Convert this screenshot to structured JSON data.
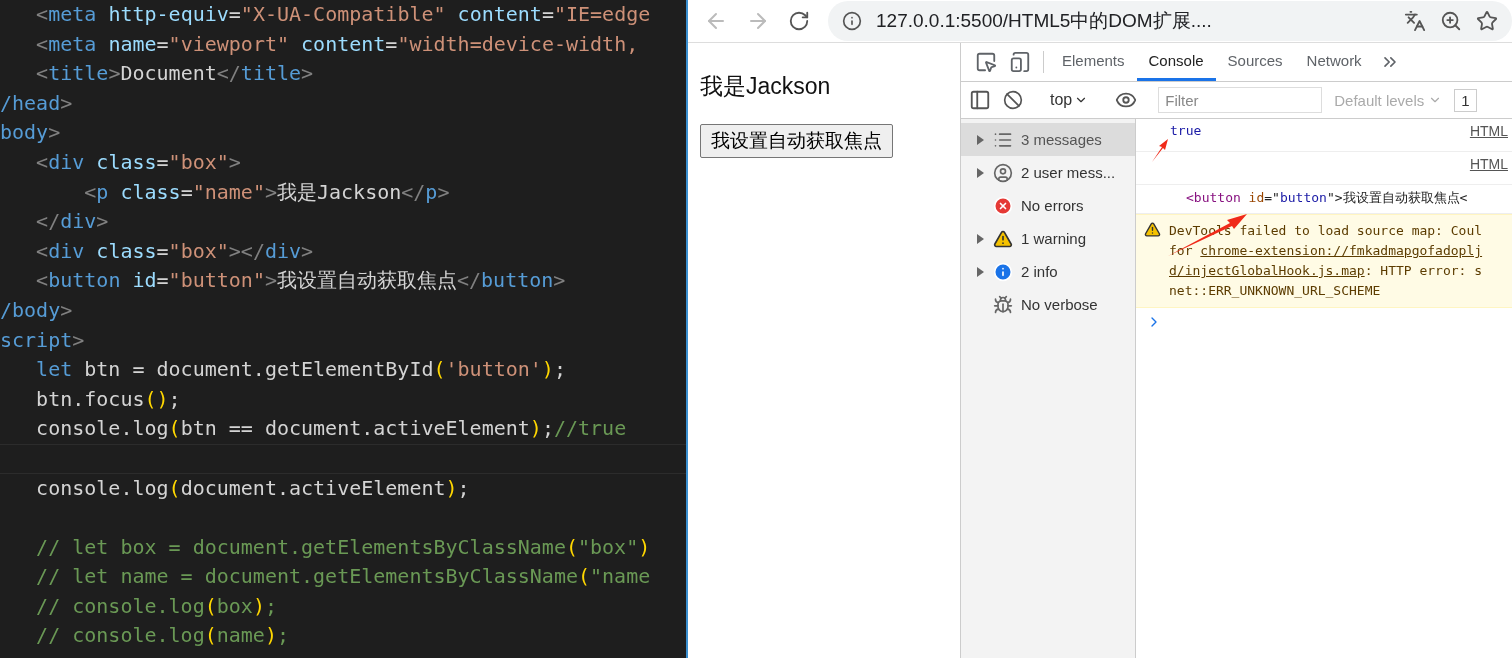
{
  "editor": {
    "lines": [
      {
        "tokens": [
          {
            "kind": "punct",
            "text": "   <"
          },
          {
            "kind": "tag",
            "text": "meta"
          },
          {
            "kind": "attr",
            "text": " http-equiv"
          },
          {
            "kind": "text",
            "text": "="
          },
          {
            "kind": "string",
            "text": "\"X-UA-Compatible\""
          },
          {
            "kind": "attr",
            "text": " content"
          },
          {
            "kind": "text",
            "text": "="
          },
          {
            "kind": "string",
            "text": "\"IE=edge"
          }
        ]
      },
      {
        "tokens": [
          {
            "kind": "punct",
            "text": "   <"
          },
          {
            "kind": "tag",
            "text": "meta"
          },
          {
            "kind": "attr",
            "text": " name"
          },
          {
            "kind": "text",
            "text": "="
          },
          {
            "kind": "string",
            "text": "\"viewport\""
          },
          {
            "kind": "attr",
            "text": " content"
          },
          {
            "kind": "text",
            "text": "="
          },
          {
            "kind": "string",
            "text": "\"width=device-width,"
          }
        ]
      },
      {
        "tokens": [
          {
            "kind": "punct",
            "text": "   <"
          },
          {
            "kind": "tag",
            "text": "title"
          },
          {
            "kind": "punct",
            "text": ">"
          },
          {
            "kind": "text",
            "text": "Document"
          },
          {
            "kind": "punct",
            "text": "</"
          },
          {
            "kind": "tag",
            "text": "title"
          },
          {
            "kind": "punct",
            "text": ">"
          }
        ]
      },
      {
        "tokens": [
          {
            "kind": "tag",
            "text": "/head"
          },
          {
            "kind": "punct",
            "text": ">"
          }
        ]
      },
      {
        "tokens": [
          {
            "kind": "tag",
            "text": "body"
          },
          {
            "kind": "punct",
            "text": ">"
          }
        ]
      },
      {
        "tokens": [
          {
            "kind": "punct",
            "text": "   <"
          },
          {
            "kind": "tag",
            "text": "div"
          },
          {
            "kind": "attr",
            "text": " class"
          },
          {
            "kind": "text",
            "text": "="
          },
          {
            "kind": "string",
            "text": "\"box\""
          },
          {
            "kind": "punct",
            "text": ">"
          }
        ]
      },
      {
        "tokens": [
          {
            "kind": "punct",
            "text": "       <"
          },
          {
            "kind": "tag",
            "text": "p"
          },
          {
            "kind": "attr",
            "text": " class"
          },
          {
            "kind": "text",
            "text": "="
          },
          {
            "kind": "string",
            "text": "\"name\""
          },
          {
            "kind": "punct",
            "text": ">"
          },
          {
            "kind": "text",
            "text": "我是Jackson"
          },
          {
            "kind": "punct",
            "text": "</"
          },
          {
            "kind": "tag",
            "text": "p"
          },
          {
            "kind": "punct",
            "text": ">"
          }
        ]
      },
      {
        "tokens": [
          {
            "kind": "punct",
            "text": "   </"
          },
          {
            "kind": "tag",
            "text": "div"
          },
          {
            "kind": "punct",
            "text": ">"
          }
        ]
      },
      {
        "tokens": [
          {
            "kind": "punct",
            "text": "   <"
          },
          {
            "kind": "tag",
            "text": "div"
          },
          {
            "kind": "attr",
            "text": " class"
          },
          {
            "kind": "text",
            "text": "="
          },
          {
            "kind": "string",
            "text": "\"box\""
          },
          {
            "kind": "punct",
            "text": "></"
          },
          {
            "kind": "tag",
            "text": "div"
          },
          {
            "kind": "punct",
            "text": ">"
          }
        ]
      },
      {
        "tokens": [
          {
            "kind": "punct",
            "text": "   <"
          },
          {
            "kind": "tag",
            "text": "button"
          },
          {
            "kind": "attr",
            "text": " id"
          },
          {
            "kind": "text",
            "text": "="
          },
          {
            "kind": "string",
            "text": "\"button\""
          },
          {
            "kind": "punct",
            "text": ">"
          },
          {
            "kind": "text",
            "text": "我设置自动获取焦点"
          },
          {
            "kind": "punct",
            "text": "</"
          },
          {
            "kind": "tag",
            "text": "button"
          },
          {
            "kind": "punct",
            "text": ">"
          }
        ]
      },
      {
        "tokens": [
          {
            "kind": "tag",
            "text": "/body"
          },
          {
            "kind": "punct",
            "text": ">"
          }
        ]
      },
      {
        "tokens": [
          {
            "kind": "tag",
            "text": "script"
          },
          {
            "kind": "punct",
            "text": ">"
          }
        ]
      },
      {
        "tokens": [
          {
            "kind": "keyword",
            "text": "   let"
          },
          {
            "kind": "text",
            "text": " btn = document.getElementById"
          },
          {
            "kind": "paren",
            "text": "("
          },
          {
            "kind": "string",
            "text": "'button'"
          },
          {
            "kind": "paren",
            "text": ")"
          },
          {
            "kind": "text",
            "text": ";"
          }
        ]
      },
      {
        "tokens": [
          {
            "kind": "text",
            "text": "   btn.focus"
          },
          {
            "kind": "paren",
            "text": "()"
          },
          {
            "kind": "text",
            "text": ";"
          }
        ]
      },
      {
        "tokens": [
          {
            "kind": "text",
            "text": "   console.log"
          },
          {
            "kind": "paren",
            "text": "("
          },
          {
            "kind": "text",
            "text": "btn == document.activeElement"
          },
          {
            "kind": "paren",
            "text": ")"
          },
          {
            "kind": "text",
            "text": ";"
          },
          {
            "kind": "comment",
            "text": "//true"
          }
        ]
      },
      {
        "kind": "current"
      },
      {
        "tokens": [
          {
            "kind": "text",
            "text": "   console.log"
          },
          {
            "kind": "paren",
            "text": "("
          },
          {
            "kind": "text",
            "text": "document.activeElement"
          },
          {
            "kind": "paren",
            "text": ")"
          },
          {
            "kind": "text",
            "text": ";"
          }
        ]
      },
      {
        "kind": "blank"
      },
      {
        "tokens": [
          {
            "kind": "comment",
            "text": "   // let box = document.getElementsByClassName"
          },
          {
            "kind": "paren",
            "text": "("
          },
          {
            "kind": "comment",
            "text": "\"box\""
          },
          {
            "kind": "paren",
            "text": ")"
          }
        ]
      },
      {
        "tokens": [
          {
            "kind": "comment",
            "text": "   // let name = document.getElementsByClassName"
          },
          {
            "kind": "paren",
            "text": "("
          },
          {
            "kind": "comment",
            "text": "\"name"
          }
        ]
      },
      {
        "tokens": [
          {
            "kind": "comment",
            "text": "   // console.log"
          },
          {
            "kind": "paren",
            "text": "("
          },
          {
            "kind": "comment",
            "text": "box"
          },
          {
            "kind": "paren",
            "text": ")"
          },
          {
            "kind": "comment",
            "text": ";"
          }
        ]
      },
      {
        "tokens": [
          {
            "kind": "comment",
            "text": "   // console.log"
          },
          {
            "kind": "paren",
            "text": "("
          },
          {
            "kind": "comment",
            "text": "name"
          },
          {
            "kind": "paren",
            "text": ")"
          },
          {
            "kind": "comment",
            "text": ";"
          }
        ]
      }
    ]
  },
  "browser": {
    "address": "127.0.0.1:5500/HTML5中的DOM扩展....",
    "page": {
      "heading": "我是Jackson",
      "button": "我设置自动获取焦点"
    },
    "devtools": {
      "tabs": [
        {
          "label": "Elements",
          "selected": false
        },
        {
          "label": "Console",
          "selected": true
        },
        {
          "label": "Sources",
          "selected": false
        },
        {
          "label": "Network",
          "selected": false
        }
      ],
      "context": "top",
      "filter": {
        "placeholder": "Filter"
      },
      "levels": "Default levels",
      "issues": "1",
      "sidebar": [
        {
          "kind": "list",
          "label": "3 messages",
          "expandable": true,
          "selected": true
        },
        {
          "kind": "user",
          "label": "2 user mess...",
          "expandable": true,
          "selected": false
        },
        {
          "kind": "error",
          "label": "No errors",
          "expandable": false,
          "selected": false
        },
        {
          "kind": "warning",
          "label": "1 warning",
          "expandable": true,
          "selected": false
        },
        {
          "kind": "info",
          "label": "2 info",
          "expandable": true,
          "selected": false
        },
        {
          "kind": "verbose",
          "label": "No verbose",
          "expandable": false,
          "selected": false
        }
      ],
      "messages": [
        {
          "kind": "value",
          "text": "true",
          "source": "HTML"
        },
        {
          "kind": "element",
          "source": "HTML",
          "tokens": [
            {
              "kind": "punct",
              "text": "<"
            },
            {
              "kind": "tag",
              "text": "button"
            },
            {
              "kind": "attr",
              "text": " id"
            },
            {
              "kind": "text",
              "text": "=\""
            },
            {
              "kind": "string",
              "text": "button"
            },
            {
              "kind": "text",
              "text": "\">我设置自动获取焦点<"
            }
          ]
        },
        {
          "kind": "warning",
          "lines": [
            [
              {
                "text": "DevTools failed to load source map: Coul"
              }
            ],
            [
              {
                "text": "for "
              },
              {
                "text": "chrome-extension://fmkadmapgofadoplj",
                "link": true
              }
            ],
            [
              {
                "text": "d/injectGlobalHook.js.map",
                "link": true
              },
              {
                "text": ": HTTP error: s"
              }
            ],
            [
              {
                "text": "net::ERR_UNKNOWN_URL_SCHEME"
              }
            ]
          ]
        }
      ]
    }
  }
}
